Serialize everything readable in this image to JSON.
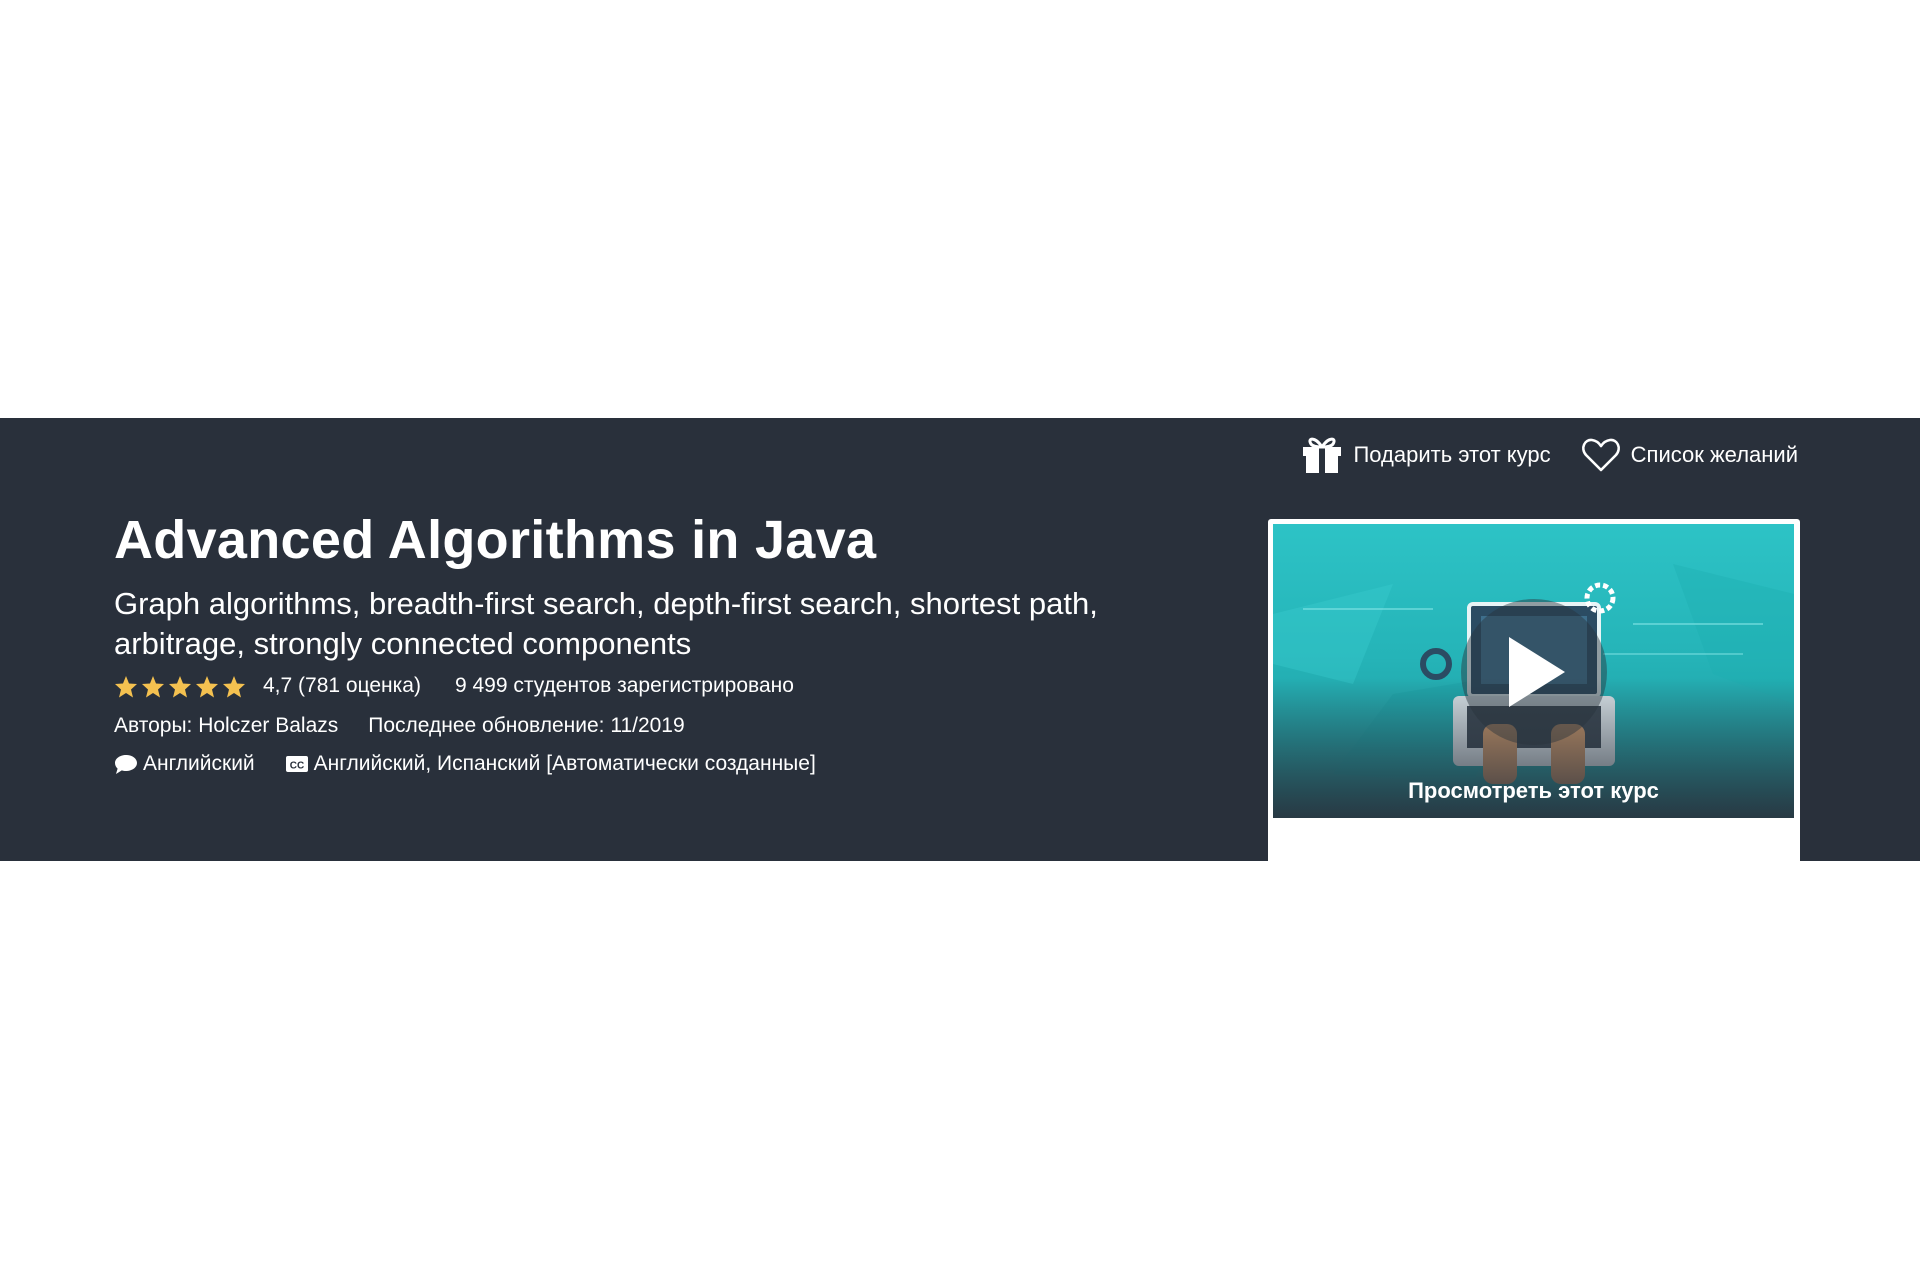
{
  "header_actions": {
    "gift_label": "Подарить этот курс",
    "wishlist_label": "Список желаний"
  },
  "course": {
    "title": "Advanced Algorithms in Java",
    "subtitle": "Graph algorithms, breadth-first search, depth-first search, shortest path, arbitrage, strongly connected components",
    "rating": {
      "stars": 4.7,
      "text": "4,7 (781 оценка)"
    },
    "students": "9 499 студентов зарегистрировано",
    "authors": "Авторы: Holczer Balazs",
    "last_updated": "Последнее обновление: 11/2019",
    "language": "Английский",
    "captions": "Английский, Испанский [Автоматически созданные]"
  },
  "preview": {
    "label": "Просмотреть этот курс"
  },
  "colors": {
    "banner_bg": "#29303b",
    "star": "#f4c150",
    "text": "#ffffff",
    "preview_teal": "#2dc3c6"
  },
  "icons": {
    "gift": "gift-icon",
    "wishlist": "heart-icon",
    "star": "star-icon",
    "language": "speech-bubble-icon",
    "captions": "closed-captions-icon",
    "play": "play-icon"
  }
}
